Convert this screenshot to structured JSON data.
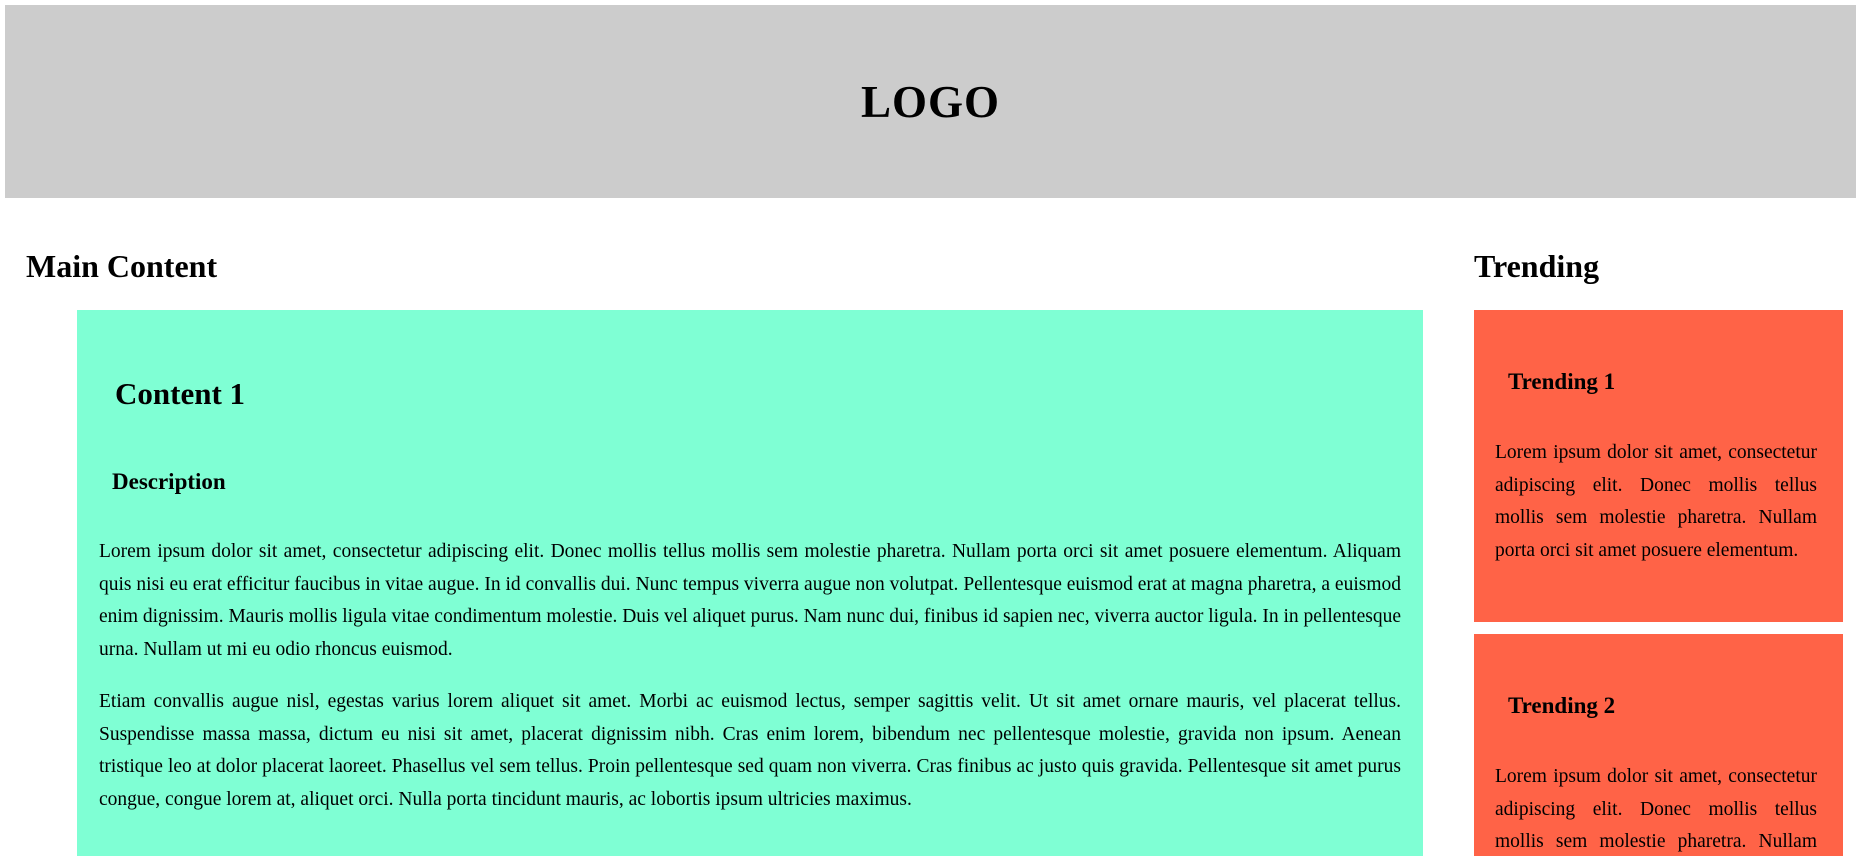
{
  "header": {
    "logo_text": "LOGO"
  },
  "main": {
    "section_title": "Main Content",
    "cards": [
      {
        "title": "Content 1",
        "subtitle": "Description",
        "paragraphs": [
          "Lorem ipsum dolor sit amet, consectetur adipiscing elit. Donec mollis tellus mollis sem molestie pharetra. Nullam porta orci sit amet posuere elementum. Aliquam quis nisi eu erat efficitur faucibus in vitae augue. In id convallis dui. Nunc tempus viverra augue non volutpat. Pellentesque euismod erat at magna pharetra, a euismod enim dignissim. Mauris mollis ligula vitae condimentum molestie. Duis vel aliquet purus. Nam nunc dui, finibus id sapien nec, viverra auctor ligula. In in pellentesque urna. Nullam ut mi eu odio rhoncus euismod.",
          "Etiam convallis augue nisl, egestas varius lorem aliquet sit amet. Morbi ac euismod lectus, semper sagittis velit. Ut sit amet ornare mauris, vel placerat tellus. Suspendisse massa massa, dictum eu nisi sit amet, placerat dignissim nibh. Cras enim lorem, bibendum nec pellentesque molestie, gravida non ipsum. Aenean tristique leo at dolor placerat laoreet. Phasellus vel sem tellus. Proin pellentesque sed quam non viverra. Cras finibus ac justo quis gravida. Pellentesque sit amet purus congue, congue lorem at, aliquet orci. Nulla porta tincidunt mauris, ac lobortis ipsum ultricies maximus."
        ]
      }
    ]
  },
  "trending": {
    "section_title": "Trending",
    "items": [
      {
        "title": "Trending 1",
        "text": "Lorem ipsum dolor sit amet, consectetur adipiscing elit. Donec mollis tellus mollis sem molestie pharetra. Nullam porta orci sit amet posuere elementum."
      },
      {
        "title": "Trending 2",
        "text": "Lorem ipsum dolor sit amet, consectetur adipiscing elit. Donec mollis tellus mollis sem molestie pharetra. Nullam porta orci sit amet posuere elementum."
      }
    ]
  },
  "colors": {
    "header_bg": "#cccccc",
    "content_bg": "#7fffd4",
    "trending_bg": "#ff6347"
  }
}
